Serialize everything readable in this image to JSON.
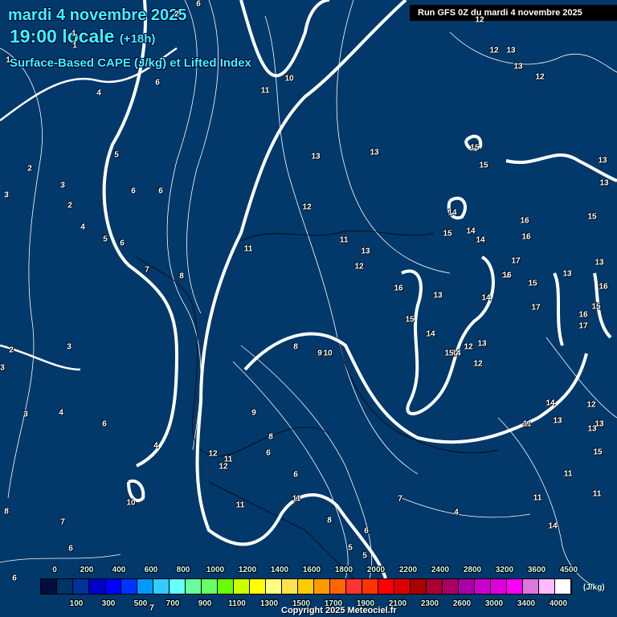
{
  "header": {
    "date": "mardi 4 novembre 2025",
    "time": "19:00 locale",
    "lead": "(+18h)",
    "product": "Surface-Based CAPE (J/kg) et Lifted Index"
  },
  "run_label": "Run GFS 0Z du mardi 4 novembre 2025",
  "colorbar": {
    "unit": "(J/kg)",
    "top_labels": [
      "0",
      "200",
      "400",
      "600",
      "800",
      "1000",
      "1200",
      "1400",
      "1600",
      "1800",
      "2000",
      "2200",
      "2400",
      "2800",
      "3200",
      "3600",
      "4500"
    ],
    "bottom_labels": [
      "100",
      "300",
      "500",
      "700",
      "900",
      "1100",
      "1300",
      "1500",
      "1700",
      "1900",
      "2100",
      "2300",
      "2600",
      "3000",
      "3400",
      "4000"
    ],
    "colors": [
      "#000f3d",
      "#003366",
      "#003399",
      "#0000cc",
      "#0000ff",
      "#0033ff",
      "#0099ff",
      "#33ccff",
      "#66ffff",
      "#66ff99",
      "#66ff66",
      "#66ff00",
      "#ccff00",
      "#ffff00",
      "#ffff80",
      "#ffe24d",
      "#ffcc00",
      "#ff9900",
      "#ff6600",
      "#ff3333",
      "#ff3300",
      "#ff0000",
      "#dd0000",
      "#aa0000",
      "#aa0033",
      "#aa0066",
      "#aa00aa",
      "#cc00cc",
      "#dd00dd",
      "#ff00ff",
      "#dd77dd",
      "#ffbbff",
      "#ffffff"
    ]
  },
  "lifted_index_labels": [
    "1",
    "2",
    "6",
    "1",
    "1",
    "12",
    "12",
    "13",
    "13",
    "12",
    "10",
    "11",
    "6",
    "4",
    "5",
    "2",
    "3",
    "3",
    "2",
    "6",
    "6",
    "4",
    "5",
    "6",
    "7",
    "8",
    "11",
    "13",
    "13",
    "12",
    "11",
    "13",
    "12",
    "15",
    "15",
    "14",
    "15",
    "14",
    "14",
    "16",
    "13",
    "13",
    "15",
    "16",
    "17",
    "16",
    "15",
    "13",
    "16",
    "13",
    "17",
    "16",
    "14",
    "17",
    "15",
    "2",
    "3",
    "3",
    "3",
    "4",
    "6",
    "16",
    "13",
    "14",
    "16",
    "15",
    "12",
    "13",
    "14",
    "15",
    "12",
    "8",
    "9",
    "10",
    "9",
    "8",
    "6",
    "4",
    "12",
    "11",
    "12",
    "10",
    "6",
    "11",
    "11",
    "8",
    "7",
    "4",
    "6",
    "5",
    "14",
    "11",
    "11",
    "12",
    "13",
    "13",
    "15",
    "11",
    "13",
    "14",
    "11",
    "7",
    "6",
    "8",
    "6",
    "7",
    "5"
  ],
  "copyright": "Copyright 2025 Meteociel.fr"
}
